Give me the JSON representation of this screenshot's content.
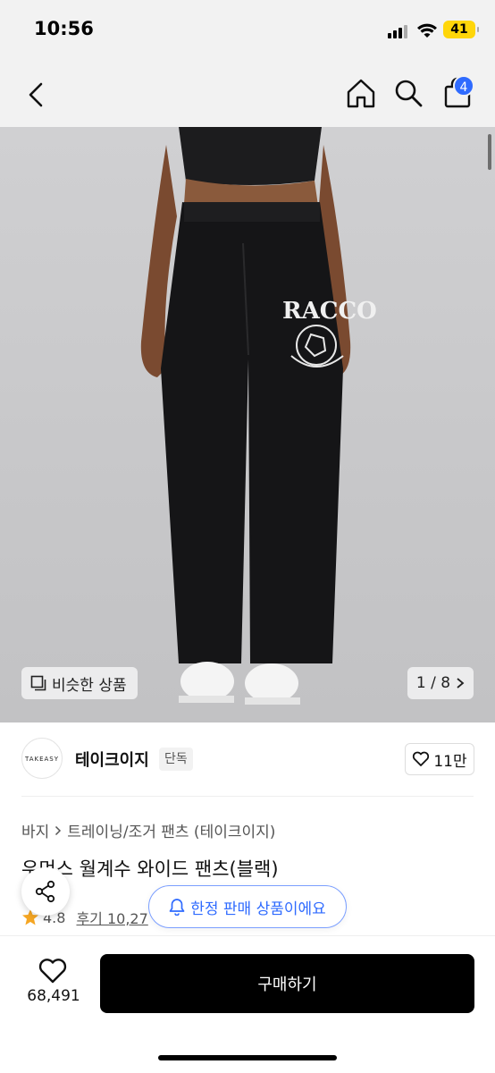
{
  "status_bar": {
    "time": "10:56",
    "battery": "41"
  },
  "nav": {
    "cart_count": "4",
    "icons": [
      "back-arrow-icon",
      "home-icon",
      "search-icon",
      "shopping-bag-icon"
    ]
  },
  "hero": {
    "similar_label": "비슷한 상품",
    "page_indicator": "1 / 8",
    "print_text": "RACCO"
  },
  "brand": {
    "logo_text": "TAKEASY",
    "name": "테이크이지",
    "tag": "단독",
    "likes": "11만"
  },
  "product": {
    "breadcrumb": [
      "바지",
      "트레이닝/조거 팬츠 (테이크이지)"
    ],
    "title": "우먼스 월계수 와이드 팬츠(블랙)",
    "rating": "4.8",
    "reviews": "후기 10,27"
  },
  "floating": {
    "limited_label": "한정 판매 상품이에요"
  },
  "bottom": {
    "wish_count": "68,491",
    "buy_label": "구매하기"
  },
  "colors": {
    "accent": "#2f6bff",
    "star": "#f5a623",
    "buy_bg": "#000000"
  }
}
